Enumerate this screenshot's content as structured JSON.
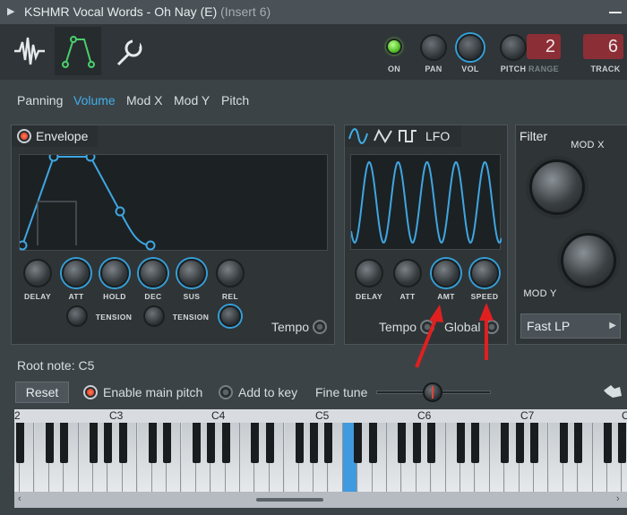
{
  "window": {
    "title": "KSHMR Vocal Words - Oh Nay (E)",
    "subtitle": "(Insert 6)"
  },
  "header": {
    "tabs": [
      {
        "icon": "waveform-icon"
      },
      {
        "icon": "envelope-node-icon"
      },
      {
        "icon": "wrench-icon"
      }
    ],
    "on_label": "ON",
    "pan_label": "PAN",
    "vol_label": "VOL",
    "pitch_label": "PITCH",
    "range_label": "RANGE",
    "range_value": "2",
    "track_label": "TRACK",
    "track_value": "6"
  },
  "subtabs": [
    "Panning",
    "Volume",
    "Mod X",
    "Mod Y",
    "Pitch"
  ],
  "subtabs_active": "Volume",
  "envelope": {
    "title": "Envelope",
    "knobs": [
      "DELAY",
      "ATT",
      "HOLD",
      "DEC",
      "SUS",
      "REL"
    ],
    "tension_label_1": "TENSION",
    "tension_label_2": "TENSION",
    "tempo_label": "Tempo"
  },
  "lfo": {
    "title": "LFO",
    "knobs": [
      "DELAY",
      "ATT",
      "AMT",
      "SPEED"
    ],
    "tempo_label": "Tempo",
    "global_label": "Global"
  },
  "filter": {
    "title": "Filter",
    "modx_label": "MOD X",
    "mody_label": "MOD Y",
    "type_value": "Fast LP"
  },
  "keyboard_section": {
    "root_note_label": "Root note: C5",
    "reset_label": "Reset",
    "enable_main_pitch_label": "Enable main pitch",
    "add_to_key_label": "Add to key",
    "fine_tune_label": "Fine tune",
    "octave_labels": [
      "2",
      "C3",
      "C4",
      "C5",
      "C6",
      "C7",
      "C"
    ],
    "highlighted_key": "C5"
  },
  "colors": {
    "accent_blue": "#3fb0ea",
    "range_red": "#8c2e36",
    "annotation_red": "#e02020"
  }
}
